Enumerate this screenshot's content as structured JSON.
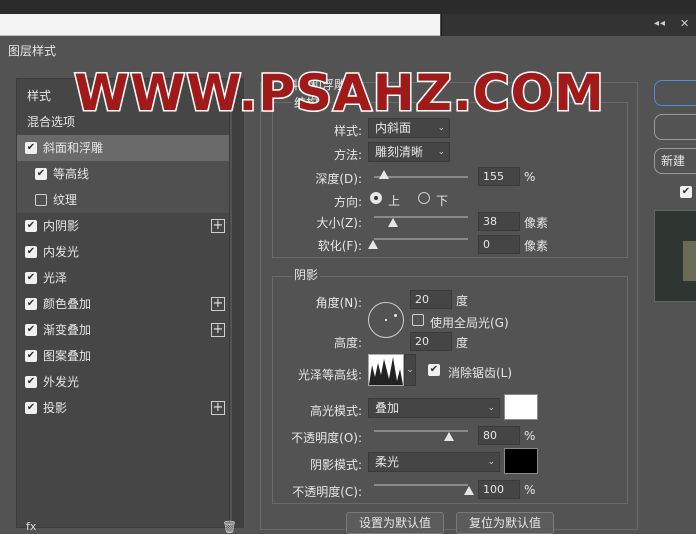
{
  "window": {
    "title": "图层样式",
    "panel_arrows": "◂◂",
    "panel_close": "✕"
  },
  "watermark": "WWW.PSAHZ.COM",
  "left_list": {
    "header_style": "样式",
    "header_blend": "混合选项",
    "items": [
      {
        "label": "斜面和浮雕",
        "checked": true
      },
      {
        "label": "等高线",
        "checked": true
      },
      {
        "label": "纹理",
        "checked": false
      },
      {
        "label": "内阴影",
        "checked": true,
        "plus": "+"
      },
      {
        "label": "内发光",
        "checked": true
      },
      {
        "label": "光泽",
        "checked": true
      },
      {
        "label": "颜色叠加",
        "checked": true,
        "plus": "+"
      },
      {
        "label": "渐变叠加",
        "checked": true,
        "plus": "+"
      },
      {
        "label": "图案叠加",
        "checked": true
      },
      {
        "label": "外发光",
        "checked": true
      },
      {
        "label": "投影",
        "checked": true,
        "plus": "+"
      }
    ],
    "fx": "fx",
    "trash": "🗑"
  },
  "bevel": {
    "section_title": "斜面和浮雕",
    "structure_title": "结构",
    "style_label": "样式:",
    "style_value": "内斜面",
    "technique_label": "方法:",
    "technique_value": "雕刻清晰",
    "depth_label": "深度(D):",
    "depth_value": "155",
    "depth_unit": "%",
    "direction_label": "方向:",
    "direction_up": "上",
    "direction_down": "下",
    "size_label": "大小(Z):",
    "size_value": "38",
    "size_unit": "像素",
    "soften_label": "软化(F):",
    "soften_value": "0",
    "soften_unit": "像素"
  },
  "shading": {
    "title": "阴影",
    "angle_label": "角度(N):",
    "angle_value": "20",
    "angle_unit": "度",
    "global_light": "使用全局光(G)",
    "altitude_label": "高度:",
    "altitude_value": "20",
    "altitude_unit": "度",
    "gloss_label": "光泽等高线:",
    "antialias": "消除锯齿(L)",
    "highlight_label": "高光模式:",
    "highlight_mode": "叠加",
    "highlight_color": "#ffffff",
    "opacity1_label": "不透明度(O):",
    "opacity1_value": "80",
    "opacity1_unit": "%",
    "shadow_label": "阴影模式:",
    "shadow_mode": "柔光",
    "shadow_color": "#000000",
    "opacity2_label": "不透明度(C):",
    "opacity2_value": "100",
    "opacity2_unit": "%"
  },
  "buttons": {
    "set_default": "设置为默认值",
    "reset_default": "复位为默认值"
  },
  "right": {
    "new_style": "新建",
    "preview_checked": true
  }
}
